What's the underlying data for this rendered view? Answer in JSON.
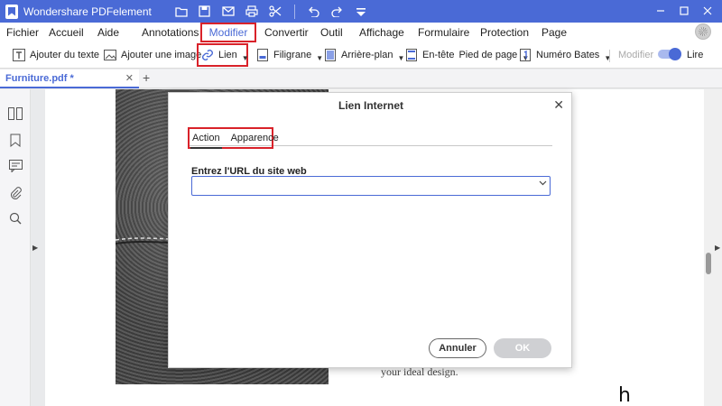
{
  "app": {
    "title": "Wondershare PDFelement",
    "accent_color": "#4a6ad6",
    "highlight_color": "#d9222a"
  },
  "quick_access": {
    "icons": [
      "folder-icon",
      "save-icon",
      "email-icon",
      "print-icon",
      "scissors-icon",
      "undo-icon",
      "redo-icon",
      "customize-icon"
    ]
  },
  "window_controls": [
    "minimize-icon",
    "maximize-icon",
    "close-icon"
  ],
  "menu": {
    "items": [
      {
        "label": "Fichier"
      },
      {
        "label": "Accueil"
      },
      {
        "label": "Aide"
      },
      {
        "label": "Annotations"
      },
      {
        "label": "Modifier",
        "active": true
      },
      {
        "label": "Convertir"
      },
      {
        "label": "Outil"
      },
      {
        "label": "Affichage"
      },
      {
        "label": "Formulaire"
      },
      {
        "label": "Protection"
      },
      {
        "label": "Page"
      }
    ]
  },
  "toolbar": {
    "add_text": "Ajouter du texte",
    "add_image": "Ajouter une image",
    "link": "Lien",
    "watermark": "Filigrane",
    "background": "Arrière-plan",
    "header": "En-tête",
    "footer": "Pied de page",
    "bates": "Numéro Bates",
    "edit_mode": "Modifier",
    "read_mode": "Lire"
  },
  "tabs": {
    "document": "Furniture.pdf *"
  },
  "page": {
    "text": "your ideal design.",
    "glyph": "h"
  },
  "dialog": {
    "title": "Lien Internet",
    "tabs": [
      "Action",
      "Apparence"
    ],
    "url_label": "Entrez l'URL du site web",
    "url_value": "",
    "cancel": "Annuler",
    "ok": "OK"
  }
}
